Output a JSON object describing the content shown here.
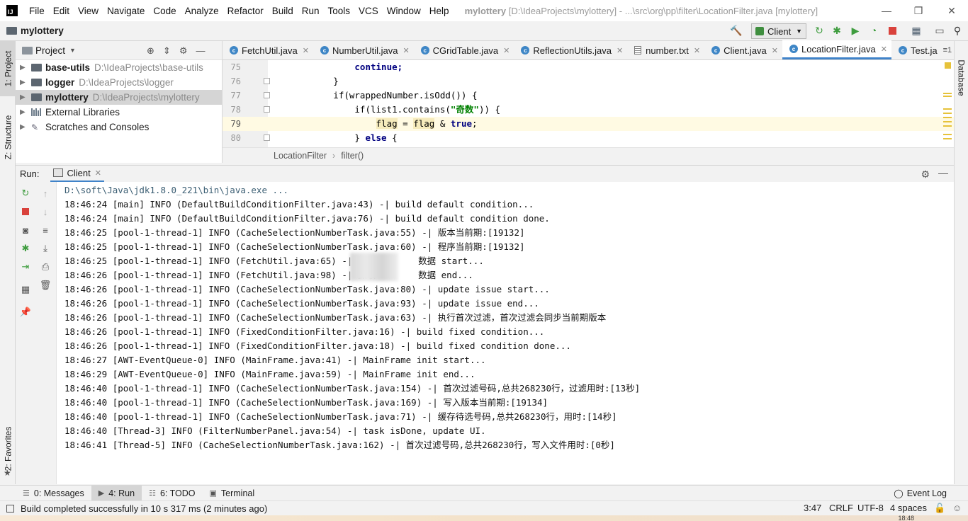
{
  "menubar": {
    "logo": "IJ",
    "items": [
      "File",
      "Edit",
      "View",
      "Navigate",
      "Code",
      "Analyze",
      "Refactor",
      "Build",
      "Run",
      "Tools",
      "VCS",
      "Window",
      "Help"
    ],
    "window_title_app": "mylottery",
    "window_title_path": "[D:\\IdeaProjects\\mylottery] - ...\\src\\org\\pp\\filter\\LocationFilter.java [mylottery]",
    "minimize": "—",
    "maximize": "❐",
    "close": "✕"
  },
  "navbar": {
    "project": "mylottery",
    "run_config": "Client"
  },
  "left_stripe": {
    "project_tab": "1: Project",
    "structure_tab": "Z: Structure",
    "favorites_tab": "2: Favorites"
  },
  "right_stripe": {
    "database_tab": "Database"
  },
  "project_panel": {
    "title": "Project",
    "tree": [
      {
        "name": "base-utils",
        "path": "D:\\IdeaProjects\\base-utils"
      },
      {
        "name": "logger",
        "path": "D:\\IdeaProjects\\logger"
      },
      {
        "name": "mylottery",
        "path": "D:\\IdeaProjects\\mylottery"
      },
      {
        "name": "External Libraries",
        "path": ""
      },
      {
        "name": "Scratches and Consoles",
        "path": ""
      }
    ]
  },
  "editor_tabs": [
    {
      "label": "FetchUtil.java",
      "icon": "class"
    },
    {
      "label": "NumberUtil.java",
      "icon": "class"
    },
    {
      "label": "CGridTable.java",
      "icon": "class"
    },
    {
      "label": "ReflectionUtils.java",
      "icon": "class"
    },
    {
      "label": "number.txt",
      "icon": "text"
    },
    {
      "label": "Client.java",
      "icon": "class"
    },
    {
      "label": "LocationFilter.java",
      "icon": "class",
      "active": true
    },
    {
      "label": "Test.ja",
      "icon": "class"
    }
  ],
  "tabs_more": "≡1",
  "editor": {
    "lines": [
      {
        "num": "75",
        "t1": "                continue;"
      },
      {
        "num": "76",
        "t1": "            }"
      },
      {
        "num": "77",
        "t1": "            if(wrappedNumber.isOdd()) {"
      },
      {
        "num": "78",
        "t1": "                if(list1.contains(",
        "str": "\"奇数\"",
        "t2": ")) {"
      },
      {
        "num": "79",
        "t1": "                    ",
        "a": "flag",
        "b": " = ",
        "c": "flag",
        "d": " & ",
        "kw": "true",
        "e": ";"
      },
      {
        "num": "80",
        "t1": "                } ",
        "kw": "else",
        "t2": " {"
      }
    ]
  },
  "breadcrumb": [
    "LocationFilter",
    "filter()"
  ],
  "run_panel": {
    "label": "Run:",
    "tab": "Client",
    "console": [
      "D:\\soft\\Java\\jdk1.8.0_221\\bin\\java.exe ...",
      "18:46:24 [main] INFO (DefaultBuildConditionFilter.java:43) -| build default condition...",
      "18:46:24 [main] INFO (DefaultBuildConditionFilter.java:76) -| build default condition done.",
      "18:46:25 [pool-1-thread-1] INFO (CacheSelectionNumberTask.java:55) -| 版本当前期:[19132]",
      "18:46:25 [pool-1-thread-1] INFO (CacheSelectionNumberTask.java:60) -| 程序当前期:[19132]",
      "18:46:25 [pool-1-thread-1] INFO (FetchUtil.java:65) -| 抓取        数据 start...",
      "18:46:26 [pool-1-thread-1] INFO (FetchUtil.java:98) -| 抓取        数据 end...",
      "18:46:26 [pool-1-thread-1] INFO (CacheSelectionNumberTask.java:80) -| update issue start...",
      "18:46:26 [pool-1-thread-1] INFO (CacheSelectionNumberTask.java:93) -| update issue end...",
      "18:46:26 [pool-1-thread-1] INFO (CacheSelectionNumberTask.java:63) -| 执行首次过滤，首次过滤会同步当前期版本",
      "18:46:26 [pool-1-thread-1] INFO (FixedConditionFilter.java:16) -| build fixed condition...",
      "18:46:26 [pool-1-thread-1] INFO (FixedConditionFilter.java:18) -| build fixed condition done...",
      "18:46:27 [AWT-EventQueue-0] INFO (MainFrame.java:41) -| MainFrame init start...",
      "18:46:29 [AWT-EventQueue-0] INFO (MainFrame.java:59) -| MainFrame init end...",
      "18:46:40 [pool-1-thread-1] INFO (CacheSelectionNumberTask.java:154) -| 首次过滤号码,总共268230行，过滤用时:[13秒]",
      "18:46:40 [pool-1-thread-1] INFO (CacheSelectionNumberTask.java:169) -| 写入版本当前期:[19134]",
      "18:46:40 [pool-1-thread-1] INFO (CacheSelectionNumberTask.java:71) -| 缓存待选号码,总共268230行，用时:[14秒]",
      "18:46:40 [Thread-3] INFO (FilterNumberPanel.java:54) -| task isDone, update UI.",
      "18:46:41 [Thread-5] INFO (CacheSelectionNumberTask.java:162) -| 首次过滤号码,总共268230行，写入文件用时:[0秒]"
    ]
  },
  "tool_tabs": [
    {
      "label": "0: Messages",
      "icon": "☰"
    },
    {
      "label": "4: Run",
      "icon": "▶",
      "active": true
    },
    {
      "label": "6: TODO",
      "icon": "☷"
    },
    {
      "label": "Terminal",
      "icon": "▣"
    }
  ],
  "event_log": "Event Log",
  "statusbar": {
    "message": "Build completed successfully in 10 s 317 ms (2 minutes ago)",
    "position": "3:47",
    "line_sep": "CRLF",
    "encoding": "UTF-8",
    "indent": "4 spaces",
    "clock": "18:48"
  }
}
